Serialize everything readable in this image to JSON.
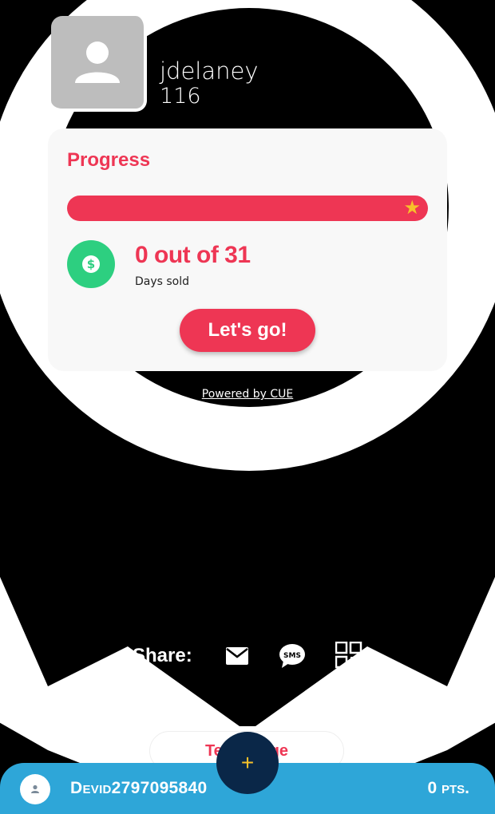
{
  "profile": {
    "username": "jdelaney",
    "number": "116"
  },
  "progress_card": {
    "title": "Progress",
    "progress_fraction": 1.0,
    "sold_text": "0 out of 31",
    "sold_label": "Days sold",
    "cta_label": "Let's go!"
  },
  "footer": {
    "powered_by": "Powered by CUE"
  },
  "share": {
    "label": "Share:",
    "icons": [
      "email-icon",
      "sms-icon",
      "qr-code-icon"
    ]
  },
  "team_button": {
    "label": "Team Page"
  },
  "bottom_bar": {
    "device_id": "Devid2797095840",
    "points": "0 pts."
  },
  "fab": {
    "symbol": "+"
  },
  "colors": {
    "accent": "#ee3654",
    "coin": "#2dcf80",
    "bar": "#2ea6d8",
    "fab": "#0a2748",
    "star": "#f7c12a"
  }
}
